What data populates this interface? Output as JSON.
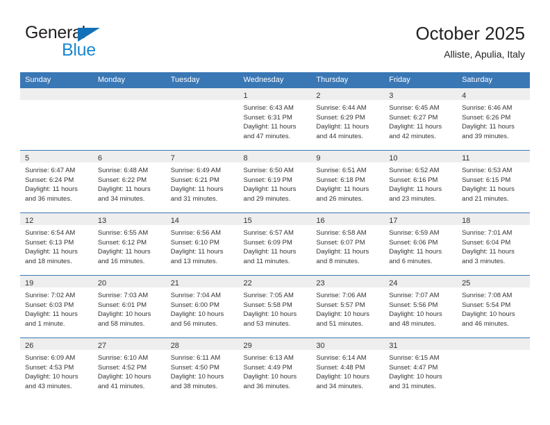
{
  "brand": {
    "name_part1": "General",
    "name_part2": "Blue",
    "accent_color": "#1271b8",
    "blue_text_color": "#1b87d2"
  },
  "header": {
    "title": "October 2025",
    "subtitle": "Alliste, Apulia, Italy"
  },
  "theme": {
    "header_row_bg": "#3a77b5",
    "day_band_bg": "#eeeeee",
    "text_color": "#333333"
  },
  "weekdays": [
    "Sunday",
    "Monday",
    "Tuesday",
    "Wednesday",
    "Thursday",
    "Friday",
    "Saturday"
  ],
  "labels": {
    "sunrise": "Sunrise:",
    "sunset": "Sunset:",
    "daylight": "Daylight:"
  },
  "weeks": [
    [
      {
        "day": "",
        "sunrise": "",
        "sunset": "",
        "daylight_line1": "",
        "daylight_line2": ""
      },
      {
        "day": "",
        "sunrise": "",
        "sunset": "",
        "daylight_line1": "",
        "daylight_line2": ""
      },
      {
        "day": "",
        "sunrise": "",
        "sunset": "",
        "daylight_line1": "",
        "daylight_line2": ""
      },
      {
        "day": "1",
        "sunrise": "Sunrise: 6:43 AM",
        "sunset": "Sunset: 6:31 PM",
        "daylight_line1": "Daylight: 11 hours",
        "daylight_line2": "and 47 minutes."
      },
      {
        "day": "2",
        "sunrise": "Sunrise: 6:44 AM",
        "sunset": "Sunset: 6:29 PM",
        "daylight_line1": "Daylight: 11 hours",
        "daylight_line2": "and 44 minutes."
      },
      {
        "day": "3",
        "sunrise": "Sunrise: 6:45 AM",
        "sunset": "Sunset: 6:27 PM",
        "daylight_line1": "Daylight: 11 hours",
        "daylight_line2": "and 42 minutes."
      },
      {
        "day": "4",
        "sunrise": "Sunrise: 6:46 AM",
        "sunset": "Sunset: 6:26 PM",
        "daylight_line1": "Daylight: 11 hours",
        "daylight_line2": "and 39 minutes."
      }
    ],
    [
      {
        "day": "5",
        "sunrise": "Sunrise: 6:47 AM",
        "sunset": "Sunset: 6:24 PM",
        "daylight_line1": "Daylight: 11 hours",
        "daylight_line2": "and 36 minutes."
      },
      {
        "day": "6",
        "sunrise": "Sunrise: 6:48 AM",
        "sunset": "Sunset: 6:22 PM",
        "daylight_line1": "Daylight: 11 hours",
        "daylight_line2": "and 34 minutes."
      },
      {
        "day": "7",
        "sunrise": "Sunrise: 6:49 AM",
        "sunset": "Sunset: 6:21 PM",
        "daylight_line1": "Daylight: 11 hours",
        "daylight_line2": "and 31 minutes."
      },
      {
        "day": "8",
        "sunrise": "Sunrise: 6:50 AM",
        "sunset": "Sunset: 6:19 PM",
        "daylight_line1": "Daylight: 11 hours",
        "daylight_line2": "and 29 minutes."
      },
      {
        "day": "9",
        "sunrise": "Sunrise: 6:51 AM",
        "sunset": "Sunset: 6:18 PM",
        "daylight_line1": "Daylight: 11 hours",
        "daylight_line2": "and 26 minutes."
      },
      {
        "day": "10",
        "sunrise": "Sunrise: 6:52 AM",
        "sunset": "Sunset: 6:16 PM",
        "daylight_line1": "Daylight: 11 hours",
        "daylight_line2": "and 23 minutes."
      },
      {
        "day": "11",
        "sunrise": "Sunrise: 6:53 AM",
        "sunset": "Sunset: 6:15 PM",
        "daylight_line1": "Daylight: 11 hours",
        "daylight_line2": "and 21 minutes."
      }
    ],
    [
      {
        "day": "12",
        "sunrise": "Sunrise: 6:54 AM",
        "sunset": "Sunset: 6:13 PM",
        "daylight_line1": "Daylight: 11 hours",
        "daylight_line2": "and 18 minutes."
      },
      {
        "day": "13",
        "sunrise": "Sunrise: 6:55 AM",
        "sunset": "Sunset: 6:12 PM",
        "daylight_line1": "Daylight: 11 hours",
        "daylight_line2": "and 16 minutes."
      },
      {
        "day": "14",
        "sunrise": "Sunrise: 6:56 AM",
        "sunset": "Sunset: 6:10 PM",
        "daylight_line1": "Daylight: 11 hours",
        "daylight_line2": "and 13 minutes."
      },
      {
        "day": "15",
        "sunrise": "Sunrise: 6:57 AM",
        "sunset": "Sunset: 6:09 PM",
        "daylight_line1": "Daylight: 11 hours",
        "daylight_line2": "and 11 minutes."
      },
      {
        "day": "16",
        "sunrise": "Sunrise: 6:58 AM",
        "sunset": "Sunset: 6:07 PM",
        "daylight_line1": "Daylight: 11 hours",
        "daylight_line2": "and 8 minutes."
      },
      {
        "day": "17",
        "sunrise": "Sunrise: 6:59 AM",
        "sunset": "Sunset: 6:06 PM",
        "daylight_line1": "Daylight: 11 hours",
        "daylight_line2": "and 6 minutes."
      },
      {
        "day": "18",
        "sunrise": "Sunrise: 7:01 AM",
        "sunset": "Sunset: 6:04 PM",
        "daylight_line1": "Daylight: 11 hours",
        "daylight_line2": "and 3 minutes."
      }
    ],
    [
      {
        "day": "19",
        "sunrise": "Sunrise: 7:02 AM",
        "sunset": "Sunset: 6:03 PM",
        "daylight_line1": "Daylight: 11 hours",
        "daylight_line2": "and 1 minute."
      },
      {
        "day": "20",
        "sunrise": "Sunrise: 7:03 AM",
        "sunset": "Sunset: 6:01 PM",
        "daylight_line1": "Daylight: 10 hours",
        "daylight_line2": "and 58 minutes."
      },
      {
        "day": "21",
        "sunrise": "Sunrise: 7:04 AM",
        "sunset": "Sunset: 6:00 PM",
        "daylight_line1": "Daylight: 10 hours",
        "daylight_line2": "and 56 minutes."
      },
      {
        "day": "22",
        "sunrise": "Sunrise: 7:05 AM",
        "sunset": "Sunset: 5:58 PM",
        "daylight_line1": "Daylight: 10 hours",
        "daylight_line2": "and 53 minutes."
      },
      {
        "day": "23",
        "sunrise": "Sunrise: 7:06 AM",
        "sunset": "Sunset: 5:57 PM",
        "daylight_line1": "Daylight: 10 hours",
        "daylight_line2": "and 51 minutes."
      },
      {
        "day": "24",
        "sunrise": "Sunrise: 7:07 AM",
        "sunset": "Sunset: 5:56 PM",
        "daylight_line1": "Daylight: 10 hours",
        "daylight_line2": "and 48 minutes."
      },
      {
        "day": "25",
        "sunrise": "Sunrise: 7:08 AM",
        "sunset": "Sunset: 5:54 PM",
        "daylight_line1": "Daylight: 10 hours",
        "daylight_line2": "and 46 minutes."
      }
    ],
    [
      {
        "day": "26",
        "sunrise": "Sunrise: 6:09 AM",
        "sunset": "Sunset: 4:53 PM",
        "daylight_line1": "Daylight: 10 hours",
        "daylight_line2": "and 43 minutes."
      },
      {
        "day": "27",
        "sunrise": "Sunrise: 6:10 AM",
        "sunset": "Sunset: 4:52 PM",
        "daylight_line1": "Daylight: 10 hours",
        "daylight_line2": "and 41 minutes."
      },
      {
        "day": "28",
        "sunrise": "Sunrise: 6:11 AM",
        "sunset": "Sunset: 4:50 PM",
        "daylight_line1": "Daylight: 10 hours",
        "daylight_line2": "and 38 minutes."
      },
      {
        "day": "29",
        "sunrise": "Sunrise: 6:13 AM",
        "sunset": "Sunset: 4:49 PM",
        "daylight_line1": "Daylight: 10 hours",
        "daylight_line2": "and 36 minutes."
      },
      {
        "day": "30",
        "sunrise": "Sunrise: 6:14 AM",
        "sunset": "Sunset: 4:48 PM",
        "daylight_line1": "Daylight: 10 hours",
        "daylight_line2": "and 34 minutes."
      },
      {
        "day": "31",
        "sunrise": "Sunrise: 6:15 AM",
        "sunset": "Sunset: 4:47 PM",
        "daylight_line1": "Daylight: 10 hours",
        "daylight_line2": "and 31 minutes."
      },
      {
        "day": "",
        "sunrise": "",
        "sunset": "",
        "daylight_line1": "",
        "daylight_line2": ""
      }
    ]
  ]
}
